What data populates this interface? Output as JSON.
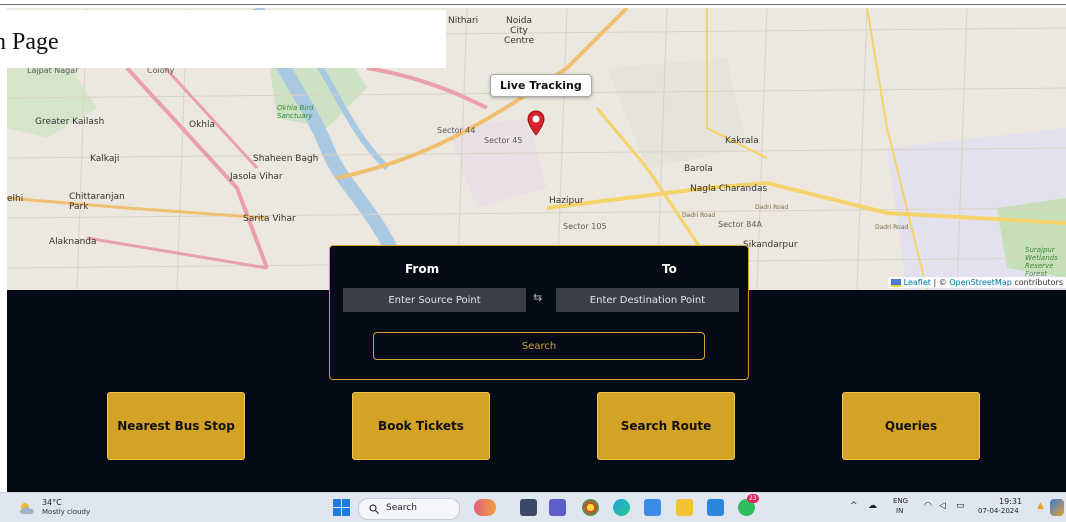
{
  "page": {
    "label": "n Page"
  },
  "map": {
    "tooltip": "Live Tracking",
    "attribution_leaflet": "Leaflet",
    "attribution_sep": " | © ",
    "attribution_osm": "OpenStreetMap",
    "attribution_tail": " contributors",
    "labels": [
      {
        "text": "Nithari",
        "cls": "bold"
      },
      {
        "text": "Noida City Centre",
        "cls": "bold"
      },
      {
        "text": "Lajpat Nagar",
        "cls": ""
      },
      {
        "text": "Colony",
        "cls": ""
      },
      {
        "text": "Okhla",
        "cls": "bold"
      },
      {
        "text": "Okhla Bird Sanctuary",
        "cls": "green"
      },
      {
        "text": "Greater Kailash",
        "cls": "bold"
      },
      {
        "text": "Kalkaji",
        "cls": "bold"
      },
      {
        "text": "Shaheen Bagh",
        "cls": "bold"
      },
      {
        "text": "Jasola Vihar",
        "cls": "bold"
      },
      {
        "text": "Chittaranjan Park",
        "cls": "bold"
      },
      {
        "text": "Sarita Vihar",
        "cls": "bold"
      },
      {
        "text": "Alaknanda",
        "cls": "bold"
      },
      {
        "text": "Kakrala",
        "cls": "bold"
      },
      {
        "text": "Barola",
        "cls": "bold"
      },
      {
        "text": "Nagla Charandas",
        "cls": "bold"
      },
      {
        "text": "Hazipur",
        "cls": "bold"
      },
      {
        "text": "Sikandarpur",
        "cls": "bold"
      },
      {
        "text": "Surajpur Wetlands Reserve Forest",
        "cls": "green"
      },
      {
        "text": "Sector 44",
        "cls": ""
      },
      {
        "text": "Sector 45",
        "cls": ""
      },
      {
        "text": "Sector 105",
        "cls": ""
      },
      {
        "text": "Sector 84A",
        "cls": ""
      },
      {
        "text": "Dadri Road",
        "cls": "road"
      },
      {
        "text": "Dadri Road",
        "cls": "road"
      },
      {
        "text": "Dadri Road",
        "cls": "road"
      },
      {
        "text": "elhi",
        "cls": "bold"
      }
    ]
  },
  "search": {
    "from_label": "From",
    "to_label": "To",
    "source_placeholder": "Enter Source Point",
    "destination_placeholder": "Enter Destination Point",
    "swap_symbol": "⇆",
    "search_label": "Search"
  },
  "actions": [
    {
      "label": "Nearest Bus Stop"
    },
    {
      "label": "Book Tickets"
    },
    {
      "label": "Search Route"
    },
    {
      "label": "Queries"
    }
  ],
  "taskbar": {
    "temperature": "34°C",
    "weather": "Mostly cloudy",
    "search_label": "Search",
    "notification_count": "23",
    "lang_line1": "ENG",
    "lang_line2": "IN",
    "time": "19:31",
    "date": "07-04-2024"
  },
  "colors": {
    "accent": "#d4a325",
    "dark_bg": "#040b17",
    "input_bg": "#3a3f47"
  }
}
